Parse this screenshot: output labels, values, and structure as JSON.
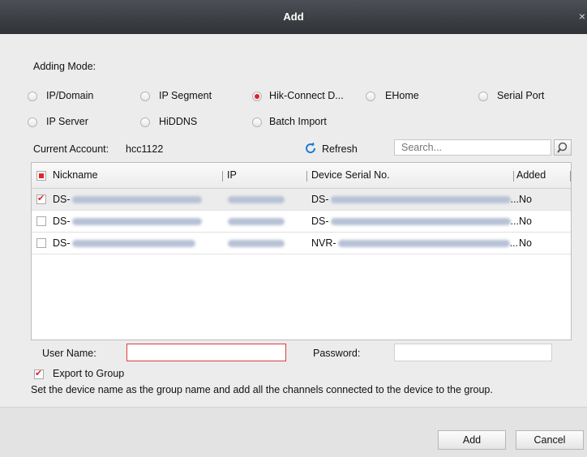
{
  "dialog": {
    "title": "Add",
    "close_glyph": "×"
  },
  "adding_mode": {
    "label": "Adding Mode:",
    "options": [
      {
        "label": "IP/Domain",
        "selected": false
      },
      {
        "label": "IP Segment",
        "selected": false
      },
      {
        "label": "Hik-Connect D...",
        "selected": true
      },
      {
        "label": "EHome",
        "selected": false
      },
      {
        "label": "Serial Port",
        "selected": false
      },
      {
        "label": "IP Server",
        "selected": false
      },
      {
        "label": "HiDDNS",
        "selected": false
      },
      {
        "label": "Batch Import",
        "selected": false
      }
    ]
  },
  "account": {
    "label": "Current Account:",
    "value": "hcc1122"
  },
  "refresh": {
    "label": "Refresh",
    "icon": "refresh-icon",
    "color": "#1a7bd4"
  },
  "search": {
    "placeholder": "Search...",
    "icon": "search-icon"
  },
  "table": {
    "columns": [
      "Nickname",
      "IP",
      "Device Serial No.",
      "Added"
    ],
    "rows": [
      {
        "nickname": "DS-",
        "serial": "DS-",
        "serial_suffix": "...",
        "added": "No",
        "checked": true
      },
      {
        "nickname": "DS-",
        "serial": "DS-",
        "serial_suffix": "...",
        "added": "No",
        "checked": false
      },
      {
        "nickname": "DS-",
        "serial": "NVR-",
        "serial_suffix": "...",
        "added": "No",
        "checked": false
      }
    ]
  },
  "credentials": {
    "username_label": "User Name:",
    "username_value": "",
    "password_label": "Password:",
    "password_value": ""
  },
  "export": {
    "label": "Export to Group",
    "checked": true,
    "note": "Set the device name as the group name and add all the channels connected to the device to the group."
  },
  "buttons": {
    "add": "Add",
    "cancel": "Cancel"
  },
  "colors": {
    "accent": "#e2232a",
    "titlebar": "#3a3d42"
  }
}
